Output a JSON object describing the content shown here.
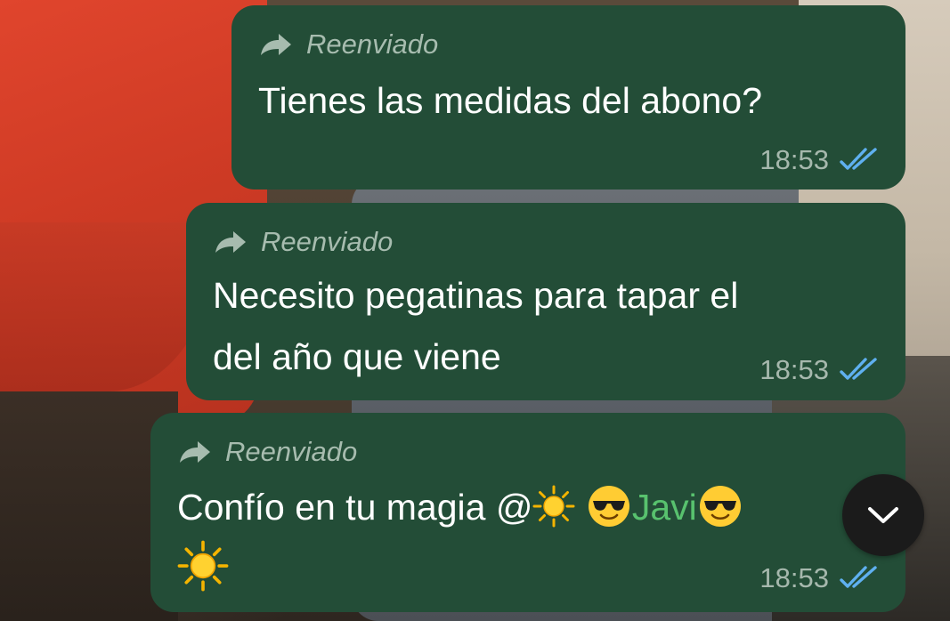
{
  "colors": {
    "bubble_bg": "#234d37",
    "text": "#ffffff",
    "forward_label": "#a7bcaf",
    "meta": "#a6b8ad",
    "read_ticks": "#5fb0f0",
    "mention": "#58c26e",
    "scroll_button_bg": "#1b1b1b"
  },
  "messages": [
    {
      "forwarded_label": "Reenviado",
      "forward_icon": "forward-arrow-icon",
      "lines": [
        "Tienes las medidas del abono?"
      ],
      "time": "18:53",
      "status": "read",
      "status_icon": "double-check-icon"
    },
    {
      "forwarded_label": "Reenviado",
      "forward_icon": "forward-arrow-icon",
      "lines": [
        "Necesito pegatinas para tapar el",
        "del año que viene"
      ],
      "time": "18:53",
      "status": "read",
      "status_icon": "double-check-icon"
    },
    {
      "forwarded_label": "Reenviado",
      "forward_icon": "forward-arrow-icon",
      "text_before_mention": "Confío en tu magia ",
      "mention": "@☀️ 😎Javi😎",
      "mention_at": "@",
      "mention_name": "Javi",
      "trailing_emoji": "☀️",
      "time": "18:53",
      "status": "read",
      "status_icon": "double-check-icon"
    }
  ],
  "scroll_button": {
    "icon": "chevron-down-icon"
  }
}
